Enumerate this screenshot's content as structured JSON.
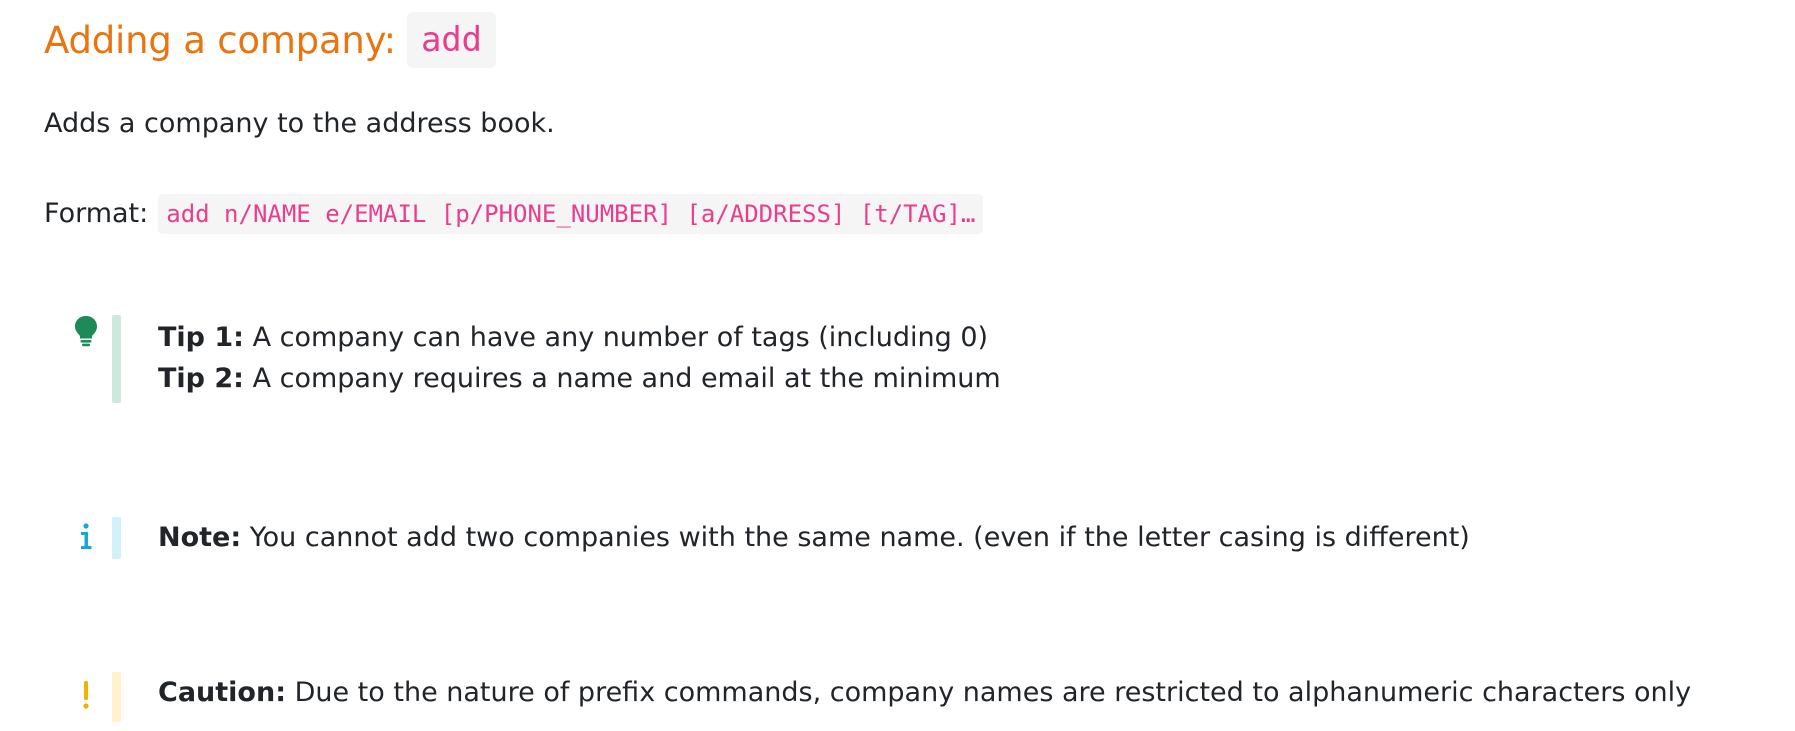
{
  "heading": {
    "title": "Adding a company:",
    "command": "add"
  },
  "description": "Adds a company to the address book.",
  "format": {
    "label": "Format:",
    "syntax": "add n/NAME e/EMAIL [p/PHONE_NUMBER] [a/ADDRESS] [t/TAG]…"
  },
  "tip_box": {
    "icon": "lightbulb-icon",
    "color": "#1e8a5a",
    "items": [
      {
        "label": "Tip 1:",
        "text": " A company can have any number of tags (including 0)"
      },
      {
        "label": "Tip 2:",
        "text": " A company requires a name and email at the minimum"
      }
    ]
  },
  "note_box": {
    "icon": "info-icon",
    "color": "#17a9d6",
    "label": "Note:",
    "text": " You cannot add two companies with the same name. (even if the letter casing is different)"
  },
  "caution_box": {
    "icon": "exclamation-icon",
    "color": "#f0b400",
    "label": "Caution:",
    "text": " Due to the nature of prefix commands, company names are restricted to alphanumeric characters only"
  }
}
